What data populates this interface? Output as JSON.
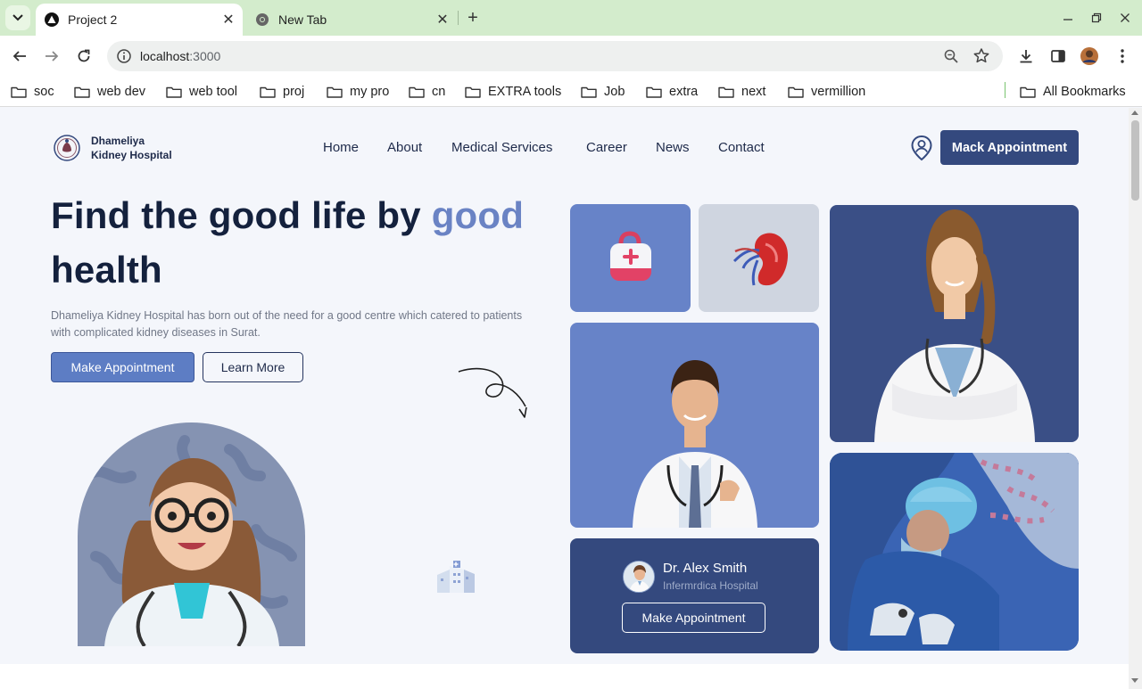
{
  "browser": {
    "tabs": [
      {
        "title": "Project 2",
        "active": true,
        "favicon": "triangle-favicon"
      },
      {
        "title": "New Tab",
        "active": false,
        "favicon": "chrome-favicon"
      }
    ],
    "new_tab_symbol": "+",
    "address": {
      "host": "localhost",
      "port": ":3000"
    },
    "bookmarks": [
      "soc",
      "web dev",
      "web tool",
      "proj",
      "my pro",
      "cn",
      "EXTRA tools",
      "Job",
      "extra",
      "next",
      "vermillion"
    ],
    "all_bookmarks": "All Bookmarks",
    "colors": {
      "tab_strip": "#d3eccc",
      "omnibox": "#eef0ef"
    }
  },
  "site": {
    "logo": {
      "line1": "Dhameliya",
      "line2": "Kidney Hospital"
    },
    "nav": [
      "Home",
      "About",
      "Medical Services",
      "Career",
      "News",
      "Contact"
    ],
    "header_button": "Mack Appointment",
    "hero": {
      "title_part1": "Find the good life by ",
      "title_accent": "good",
      "title_part2": "health",
      "description": "Dhameliya Kidney Hospital has born out of the need for a good centre which catered to patients with complicated kidney diseases in Surat.",
      "primary_button": "Make Appointment",
      "secondary_button": "Learn More"
    },
    "doctor_card": {
      "name": "Dr. Alex Smith",
      "hospital": "Infermrdica Hospital",
      "button": "Make Appointment"
    },
    "colors": {
      "primary": "#34497e",
      "accent": "#6a83c4",
      "tile_blue": "#6783c8",
      "text_dark": "#14213d"
    }
  }
}
